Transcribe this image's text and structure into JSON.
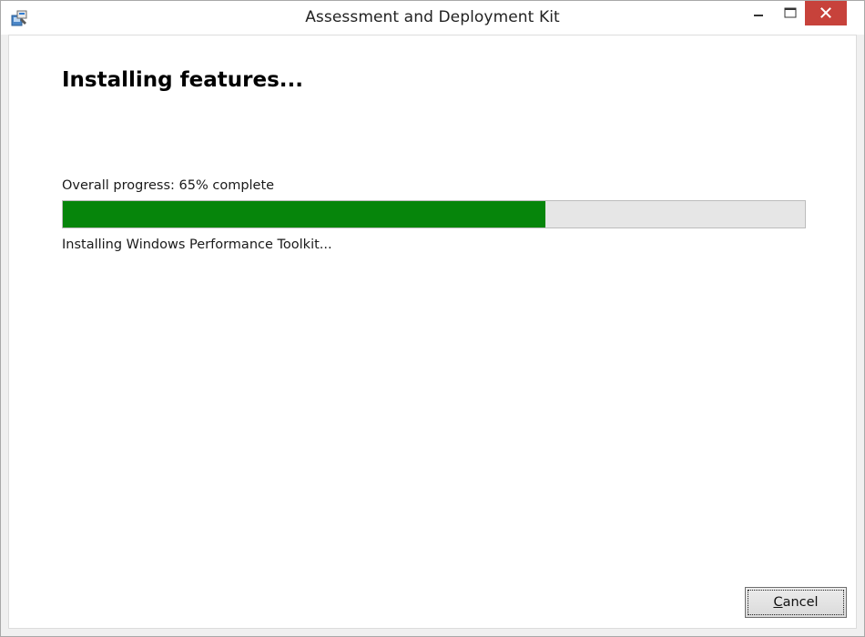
{
  "window": {
    "title": "Assessment and Deployment Kit",
    "icons": {
      "app": "installer-icon",
      "minimize": "minimize-icon",
      "maximize": "maximize-icon",
      "close": "close-icon"
    },
    "colors": {
      "close_button": "#c7423b"
    }
  },
  "main": {
    "heading": "Installing features...",
    "progress": {
      "label": "Overall progress: 65% complete",
      "percent": 65,
      "fill_color": "#06850b"
    },
    "status": "Installing Windows Performance Toolkit..."
  },
  "footer": {
    "cancel_mnemonic": "C",
    "cancel_rest": "ancel"
  }
}
